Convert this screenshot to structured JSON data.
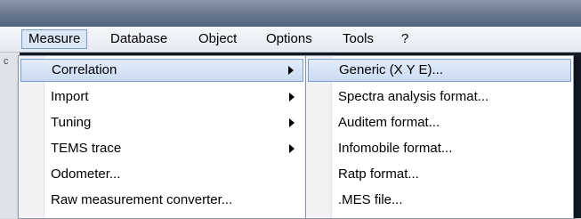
{
  "menubar": {
    "items": [
      {
        "label": "Measure"
      },
      {
        "label": "Database"
      },
      {
        "label": "Object"
      },
      {
        "label": "Options"
      },
      {
        "label": "Tools"
      },
      {
        "label": "?"
      }
    ]
  },
  "measure_menu": {
    "items": [
      {
        "label": "Correlation",
        "submenu": true
      },
      {
        "label": "Import",
        "submenu": true
      },
      {
        "label": "Tuning",
        "submenu": true
      },
      {
        "label": "TEMS trace",
        "submenu": true
      },
      {
        "label": "Odometer...",
        "submenu": false
      },
      {
        "label": "Raw measurement converter...",
        "submenu": false
      }
    ]
  },
  "correlation_submenu": {
    "items": [
      {
        "label": "Generic (X Y E)..."
      },
      {
        "label": "Spectra analysis format..."
      },
      {
        "label": "Auditem format..."
      },
      {
        "label": "Infomobile format..."
      },
      {
        "label": "Ratp format..."
      },
      {
        "label": ".MES file..."
      }
    ]
  },
  "left_strip": {
    "glyph": "c"
  }
}
